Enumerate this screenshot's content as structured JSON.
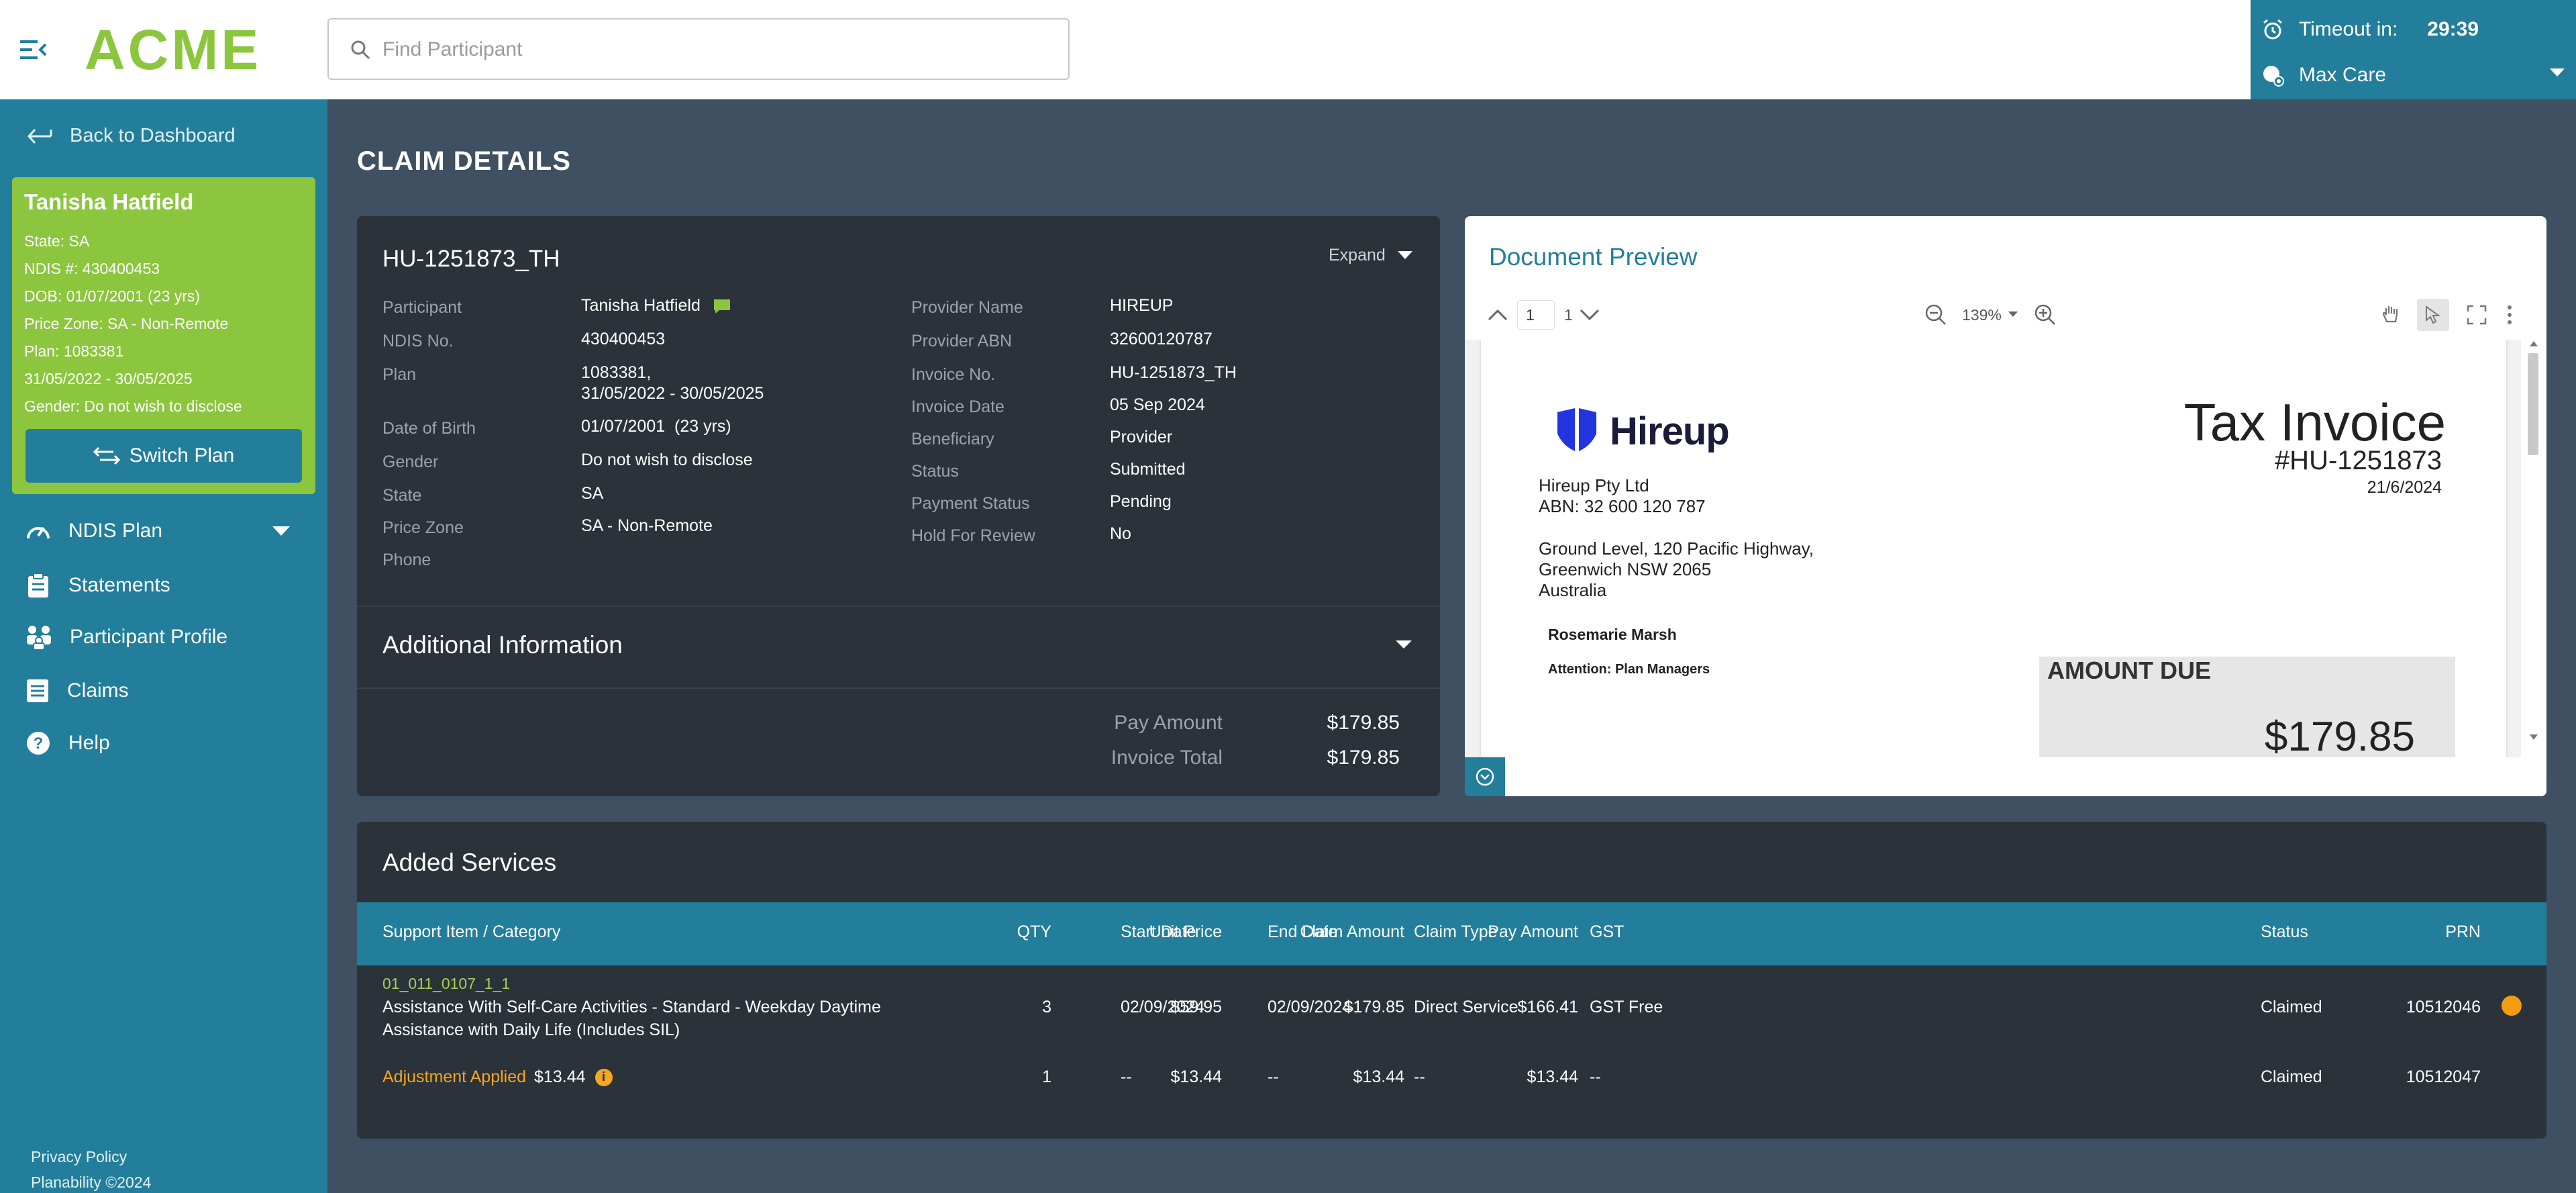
{
  "app": {
    "logo": "ACME",
    "search_placeholder": "Find Participant",
    "timeout_label": "Timeout in:",
    "timeout_value": "29:39",
    "plan_selector": "Max Care"
  },
  "sidebar": {
    "back_label": "Back to Dashboard",
    "participant": {
      "name": "Tanisha Hatfield",
      "state_label": "State:",
      "state": "SA",
      "ndis_label": "NDIS #:",
      "ndis": "430400453",
      "dob_label": "DOB:",
      "dob": "01/07/2001 (23 yrs)",
      "price_zone_label": "Price Zone:",
      "price_zone": "SA - Non-Remote",
      "plan_label": "Plan:",
      "plan": "1083381",
      "plan_dates": "31/05/2022 - 30/05/2025",
      "gender_label": "Gender:",
      "gender": "Do not wish to disclose"
    },
    "switch_plan": "Switch Plan",
    "nav": [
      {
        "label": "NDIS Plan",
        "icon": "gauge-icon"
      },
      {
        "label": "Statements",
        "icon": "clipboard-icon"
      },
      {
        "label": "Participant Profile",
        "icon": "people-icon"
      },
      {
        "label": "Claims",
        "icon": "list-icon"
      },
      {
        "label": "Help",
        "icon": "help-icon"
      }
    ],
    "footer": {
      "privacy": "Privacy Policy",
      "copyright": "Planability ©2024"
    }
  },
  "page_title": "CLAIM DETAILS",
  "claim": {
    "id": "HU-1251873_TH",
    "expand_label": "Expand",
    "left_fields": [
      {
        "label": "Participant",
        "value": "Tanisha Hatfield"
      },
      {
        "label": "NDIS No.",
        "value": "430400453"
      },
      {
        "label": "Plan",
        "value": "1083381,",
        "value2": "31/05/2022 - 30/05/2025"
      },
      {
        "label": "Date of Birth",
        "value": "01/07/2001  (23 yrs)"
      },
      {
        "label": "Gender",
        "value": "Do not wish to disclose"
      },
      {
        "label": "State",
        "value": "SA"
      },
      {
        "label": "Price Zone",
        "value": "SA - Non-Remote"
      },
      {
        "label": "Phone",
        "value": ""
      }
    ],
    "right_fields": [
      {
        "label": "Provider Name",
        "value": "HIREUP"
      },
      {
        "label": "Provider ABN",
        "value": "32600120787"
      },
      {
        "label": "Invoice No.",
        "value": "HU-1251873_TH"
      },
      {
        "label": "Invoice Date",
        "value": "05 Sep 2024"
      },
      {
        "label": "Beneficiary",
        "value": "Provider"
      },
      {
        "label": "Status",
        "value": "Submitted"
      },
      {
        "label": "Payment Status",
        "value": "Pending"
      },
      {
        "label": "Hold For Review",
        "value": "No"
      }
    ],
    "additional_info_title": "Additional Information",
    "pay_amount_label": "Pay Amount",
    "pay_amount": "$179.85",
    "invoice_total_label": "Invoice Total",
    "invoice_total": "$179.85"
  },
  "preview": {
    "title": "Document Preview",
    "page_current": "1",
    "page_total": "1",
    "zoom": "139%",
    "invoice": {
      "brand": "Hireup",
      "company": "Hireup Pty Ltd",
      "abn": "ABN: 32 600 120 787",
      "address1": "Ground Level, 120 Pacific Highway,",
      "address2": "Greenwich NSW 2065",
      "address3": "Australia",
      "recipient": "Rosemarie Marsh",
      "attention": "Attention: Plan Managers",
      "title": "Tax Invoice",
      "number": "#HU-1251873",
      "date": "21/6/2024",
      "amount_due_label": "AMOUNT DUE",
      "amount_due": "$179.85"
    }
  },
  "services": {
    "title": "Added Services",
    "columns": [
      "Support Item / Category",
      "Start Date",
      "End Date",
      "Claim Type",
      "GST",
      "QTY",
      "Unit Price",
      "Claim Amount",
      "Pay Amount",
      "Status",
      "PRN"
    ],
    "rows": [
      {
        "code": "01_011_0107_1_1",
        "desc1": "Assistance With Self-Care Activities - Standard - Weekday Daytime",
        "desc2": "Assistance with Daily Life (Includes SIL)",
        "start": "02/09/2024",
        "end": "02/09/2024",
        "claim_type": "Direct Service",
        "gst": "GST Free",
        "qty": "3",
        "unit_price": "$59.95",
        "claim_amount": "$179.85",
        "pay_amount": "$166.41",
        "status": "Claimed",
        "prn": "10512046"
      },
      {
        "adjustment_label": "Adjustment Applied",
        "adjustment_amount": "$13.44",
        "start": "--",
        "end": "--",
        "claim_type": "--",
        "gst": "--",
        "qty": "1",
        "unit_price": "$13.44",
        "claim_amount": "$13.44",
        "pay_amount": "$13.44",
        "status": "Claimed",
        "prn": "10512047"
      }
    ]
  }
}
